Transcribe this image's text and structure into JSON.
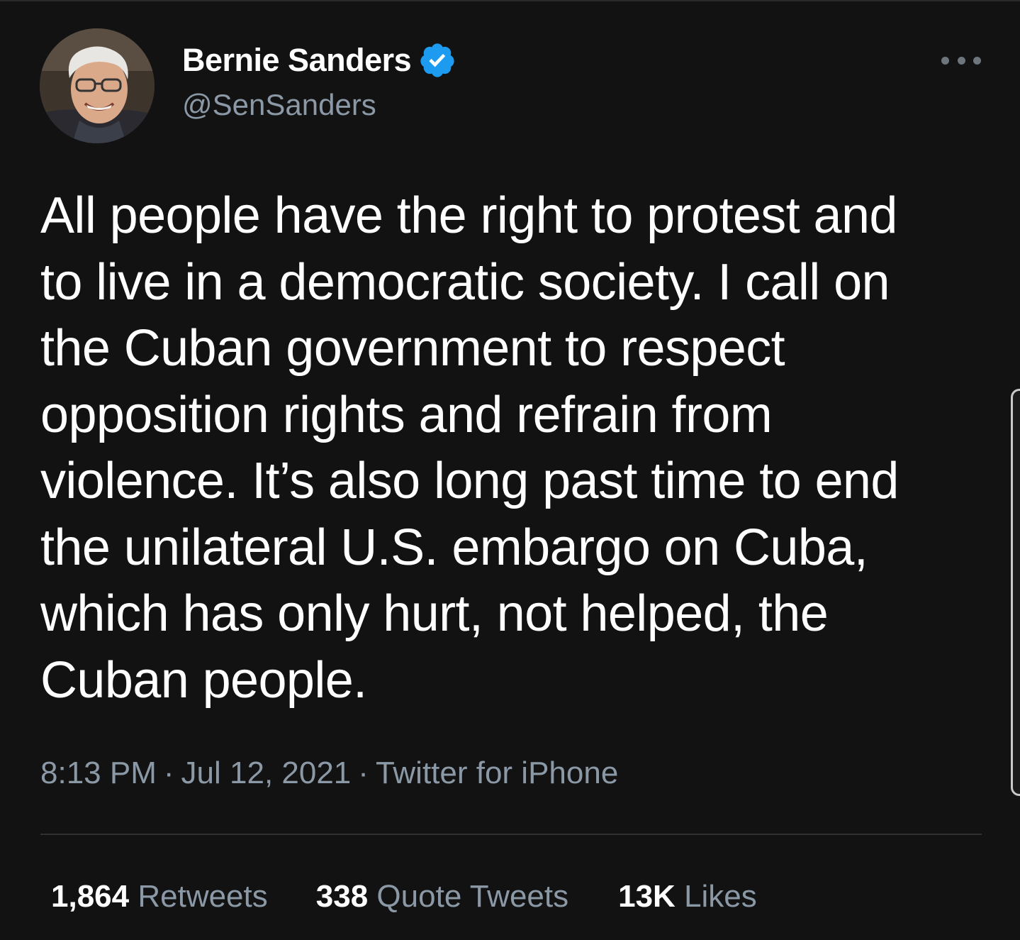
{
  "author": {
    "display_name": "Bernie Sanders",
    "handle": "@SenSanders",
    "verified_icon": "verified-badge-icon",
    "avatar_icon": "profile-photo"
  },
  "more_icon": "more-horizontal-icon",
  "tweet": {
    "lines": [
      "All people have the right to protest and",
      "to live in a democratic society. I call on",
      "the Cuban government to respect",
      "opposition rights and refrain from",
      "violence. It’s also long past time to end",
      "the unilateral U.S. embargo on Cuba,",
      "which has only hurt, not helped, the",
      "Cuban people."
    ]
  },
  "meta": {
    "time": "8:13 PM",
    "separator": "·",
    "date": "Jul 12, 2021",
    "client": "Twitter for iPhone"
  },
  "stats": {
    "retweets_count": "1,864",
    "retweets_label": "Retweets",
    "quotes_count": "338",
    "quotes_label": "Quote Tweets",
    "likes_count": "13K",
    "likes_label": "Likes"
  },
  "colors": {
    "background": "#121212",
    "text_primary": "#ffffff",
    "text_secondary": "#8b98a5",
    "verified_blue": "#1d9bf0",
    "divider": "#2f3336"
  }
}
